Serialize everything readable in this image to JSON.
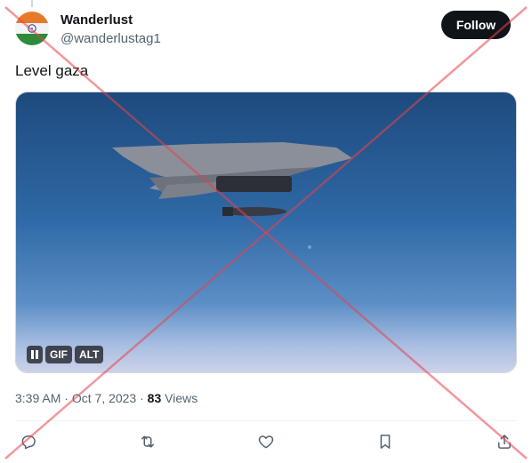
{
  "account": {
    "name": "Wanderlust",
    "handle": "@wanderlustag1",
    "follow_label": "Follow"
  },
  "tweet": {
    "text": "Level gaza",
    "time": "3:39 AM",
    "sep1": "·",
    "date": "Oct 7, 2023",
    "sep2": "·",
    "views_count": "83",
    "views_label": "Views"
  },
  "media": {
    "type": "GIF",
    "controls": {
      "gif_label": "GIF",
      "alt_label": "ALT"
    }
  },
  "actions": [
    "reply-icon",
    "repost-icon",
    "like-icon",
    "bookmark-icon",
    "share-icon"
  ],
  "colors": {
    "text": "#0f1419",
    "secondary": "#536471",
    "follow_bg": "#0f1419",
    "cross_overlay": "#e8414b"
  }
}
